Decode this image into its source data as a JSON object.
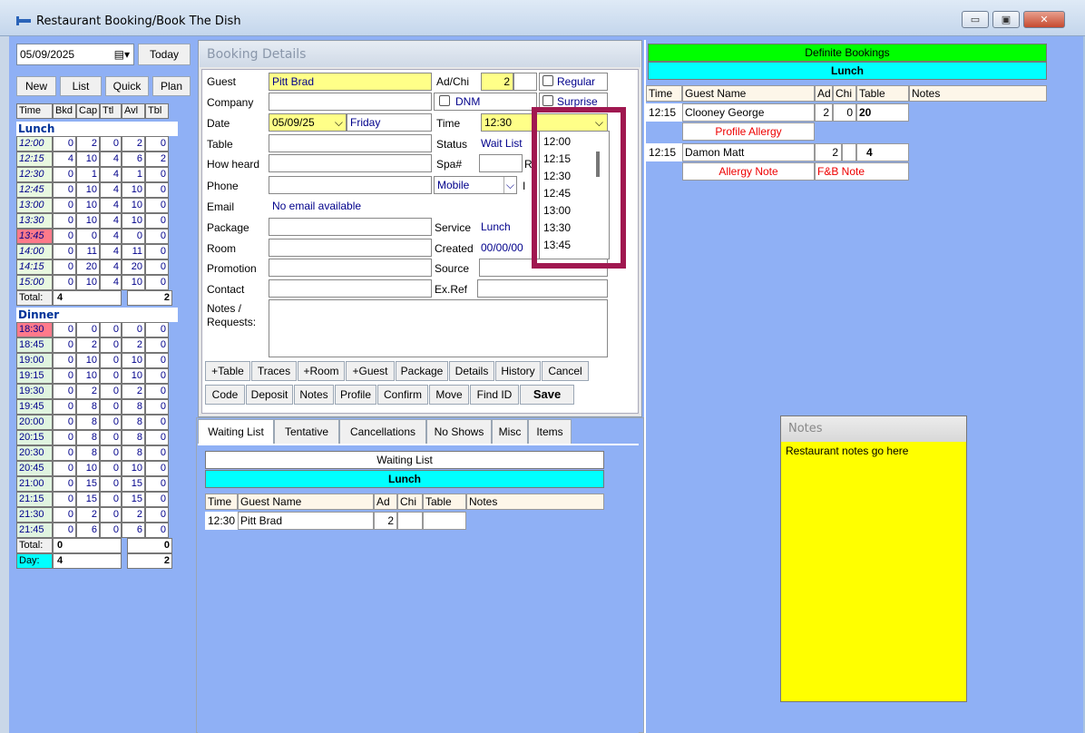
{
  "window": {
    "title": "Restaurant Booking/Book The Dish",
    "minimize": "▭",
    "maximize": "▣",
    "close": "✕"
  },
  "left": {
    "date": "05/09/2025",
    "today_label": "Today",
    "buttons": [
      "New",
      "List",
      "Quick",
      "Plan"
    ],
    "grid_headers": [
      "Time",
      "Bkd",
      "Cap",
      "Ttl",
      "Avl",
      "Tbl"
    ],
    "lunch_label": "Lunch",
    "lunch_rows": [
      [
        "12:00",
        "0",
        "2",
        "0",
        "2",
        "0"
      ],
      [
        "12:15",
        "4",
        "10",
        "4",
        "6",
        "2"
      ],
      [
        "12:30",
        "0",
        "1",
        "4",
        "1",
        "0"
      ],
      [
        "12:45",
        "0",
        "10",
        "4",
        "10",
        "0"
      ],
      [
        "13:00",
        "0",
        "10",
        "4",
        "10",
        "0"
      ],
      [
        "13:30",
        "0",
        "10",
        "4",
        "10",
        "0"
      ],
      [
        "13:45",
        "0",
        "0",
        "4",
        "0",
        "0"
      ],
      [
        "14:00",
        "0",
        "11",
        "4",
        "11",
        "0"
      ],
      [
        "14:15",
        "0",
        "20",
        "4",
        "20",
        "0"
      ],
      [
        "15:00",
        "0",
        "10",
        "4",
        "10",
        "0"
      ]
    ],
    "lunch_total_label": "Total:",
    "lunch_total_bkd": "4",
    "lunch_total_tbl": "2",
    "dinner_label": "Dinner",
    "dinner_rows": [
      [
        "18:30",
        "0",
        "0",
        "0",
        "0",
        "0"
      ],
      [
        "18:45",
        "0",
        "2",
        "0",
        "2",
        "0"
      ],
      [
        "19:00",
        "0",
        "10",
        "0",
        "10",
        "0"
      ],
      [
        "19:15",
        "0",
        "10",
        "0",
        "10",
        "0"
      ],
      [
        "19:30",
        "0",
        "2",
        "0",
        "2",
        "0"
      ],
      [
        "19:45",
        "0",
        "8",
        "0",
        "8",
        "0"
      ],
      [
        "20:00",
        "0",
        "8",
        "0",
        "8",
        "0"
      ],
      [
        "20:15",
        "0",
        "8",
        "0",
        "8",
        "0"
      ],
      [
        "20:30",
        "0",
        "8",
        "0",
        "8",
        "0"
      ],
      [
        "20:45",
        "0",
        "10",
        "0",
        "10",
        "0"
      ],
      [
        "21:00",
        "0",
        "15",
        "0",
        "15",
        "0"
      ],
      [
        "21:15",
        "0",
        "15",
        "0",
        "15",
        "0"
      ],
      [
        "21:30",
        "0",
        "2",
        "0",
        "2",
        "0"
      ],
      [
        "21:45",
        "0",
        "6",
        "0",
        "6",
        "0"
      ]
    ],
    "dinner_total_label": "Total:",
    "dinner_total_bkd": "0",
    "dinner_total_tbl": "0",
    "day_label": "Day:",
    "day_bkd": "4",
    "day_tbl": "2"
  },
  "booking": {
    "header": "Booking Details",
    "guest_label": "Guest",
    "guest": "Pitt Brad",
    "adchi_label": "Ad/Chi",
    "adults": "2",
    "children": "",
    "regular_label": "Regular",
    "company_label": "Company",
    "company": "",
    "dnm_label": "DNM",
    "surprise_label": "Surprise",
    "date_label": "Date",
    "date": "05/09/25",
    "day": "Friday",
    "time_label": "Time",
    "time": "12:30",
    "table_label": "Table",
    "table": "",
    "status_label": "Status",
    "status": "Wait List",
    "howheard_label": "How heard",
    "howheard": "",
    "spa_label": "Spa#",
    "spa": "",
    "spa_suffix": "R",
    "phone_label": "Phone",
    "phone": "",
    "phone_type": "Mobile",
    "phone_suffix": "I",
    "email_label": "Email",
    "email": "No email available",
    "package_label": "Package",
    "package": "",
    "service_label": "Service",
    "service": "Lunch",
    "room_label": "Room",
    "room": "",
    "created_label": "Created",
    "created": "00/00/00",
    "promotion_label": "Promotion",
    "promotion": "",
    "source_label": "Source",
    "source": "",
    "contact_label": "Contact",
    "contact": "",
    "exref_label": "Ex.Ref",
    "exref": "",
    "notes_label_1": "Notes /",
    "notes_label_2": "Requests:",
    "actions_row1": [
      "+Table",
      "Traces",
      "+Room",
      "+Guest",
      "Package",
      "Details",
      "History",
      "Cancel"
    ],
    "actions_row2": [
      "Code",
      "Deposit",
      "Notes",
      "Profile",
      "Confirm",
      "Move",
      "Find ID",
      "Save"
    ]
  },
  "time_dropdown": {
    "options": [
      "12:00",
      "12:15",
      "12:30",
      "12:45",
      "13:00",
      "13:30",
      "13:45"
    ]
  },
  "tabs": [
    "Waiting List",
    "Tentative",
    "Cancellations",
    "No Shows",
    "Misc",
    "Items"
  ],
  "waiting_list": {
    "title": "Waiting List",
    "section": "Lunch",
    "columns": [
      "Time",
      "Guest Name",
      "Ad",
      "Chi",
      "Table",
      "Notes"
    ],
    "rows": [
      {
        "time": "12:30",
        "name": "Pitt Brad",
        "ad": "2",
        "chi": "",
        "table": "",
        "notes": ""
      }
    ]
  },
  "definite": {
    "title": "Definite Bookings",
    "section": "Lunch",
    "columns": [
      "Time",
      "Guest Name",
      "Ad",
      "Chi",
      "Table",
      "Notes"
    ],
    "rows": [
      {
        "time": "12:15",
        "name": "Clooney George",
        "ad": "2",
        "chi": "0",
        "table": "20",
        "flag1": "Profile Allergy",
        "flag2": ""
      },
      {
        "time": "12:15",
        "name": "Damon Matt",
        "ad": "2",
        "chi": "",
        "table": "4",
        "flag1": "Allergy Note",
        "flag2": "F&B Note"
      }
    ]
  },
  "notes": {
    "header": "Notes",
    "text": "Restaurant notes go here"
  },
  "colors": {
    "green": "#00ff00",
    "cyan": "#00ffff",
    "yellow": "#ffff00",
    "highlight": "#a01850",
    "panel_blue": "#8fb0f5"
  }
}
